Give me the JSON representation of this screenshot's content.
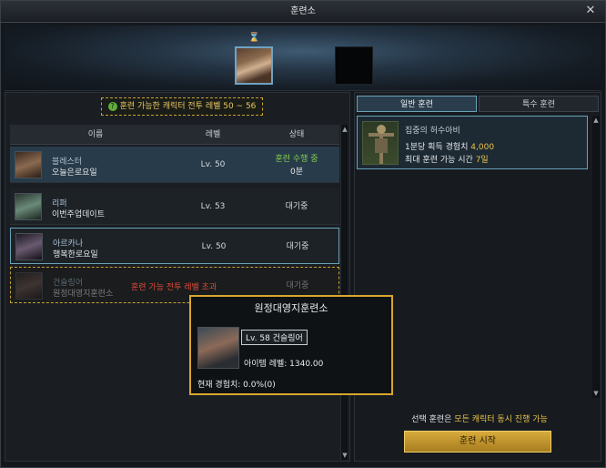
{
  "window": {
    "title": "훈련소"
  },
  "banner": {
    "hourglass": "⌛"
  },
  "filter": {
    "level_range_label": "훈련 가능한 캐릭터 전투 레벨 50 ~ 56"
  },
  "table": {
    "headers": [
      "이름",
      "레벨",
      "상태"
    ],
    "rows": [
      {
        "name": "블레스터",
        "server": "오늘은로요일",
        "level": "Lv. 50",
        "status": "훈련 수행 중",
        "status_sub": "0분"
      },
      {
        "name": "리퍼",
        "server": "이번주업데이트",
        "level": "Lv. 53",
        "status": "대기중"
      },
      {
        "name": "아르카나",
        "server": "행복한로요일",
        "level": "Lv. 50",
        "status": "대기중"
      },
      {
        "name": "건슬링어",
        "server": "원정대영지훈련소",
        "level": "Lv. 58",
        "status": "대기중",
        "warning": "훈련 가능 전투 레벨 초과"
      }
    ]
  },
  "tabs": {
    "normal": "일반 훈련",
    "special": "특수 훈련"
  },
  "training": {
    "title": "집중의 허수아비",
    "exp_label": "1분당 획득 경험치",
    "exp_value": "4,000",
    "time_label": "최대 훈련 가능 시간",
    "time_value": "7일"
  },
  "footer": {
    "desc_prefix": "선택 훈련은 ",
    "desc_highlight": "모든 캐릭터 동시 진행 가능",
    "start_button": "훈련 시작"
  },
  "tooltip": {
    "title": "원정대영지훈련소",
    "level_chip": "Lv. 58 건슬링어",
    "item_level": "아이템 레벨: 1340.00",
    "exp": "현재 경험치: 0.0%(0)"
  },
  "icons": {
    "close": "✕",
    "scroll_up": "▲",
    "scroll_down": "▼",
    "help": "?"
  },
  "colors": {
    "accent": "#6aa2b8",
    "gold": "#d8a72c",
    "in_progress": "#7fd04b",
    "warning": "#e24a3a"
  }
}
